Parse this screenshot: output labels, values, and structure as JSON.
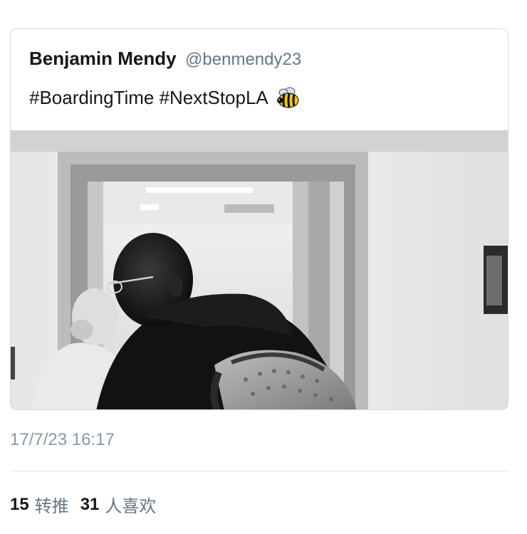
{
  "tweet": {
    "author_name": "Benjamin Mendy",
    "author_handle": "@benmendy23",
    "text": "#BoardingTime #NextStopLA",
    "emoji_icon": "bee-icon",
    "photo_description_icon": "photo",
    "timestamp": "17/7/23 16:17"
  },
  "stats": {
    "retweets_count": "15",
    "retweets_label": "转推",
    "likes_count": "31",
    "likes_label": "人喜欢"
  },
  "colors": {
    "border": "#d5dbe0",
    "text_primary": "#14171a",
    "text_secondary": "#657786",
    "timestamp": "#8899a6"
  }
}
